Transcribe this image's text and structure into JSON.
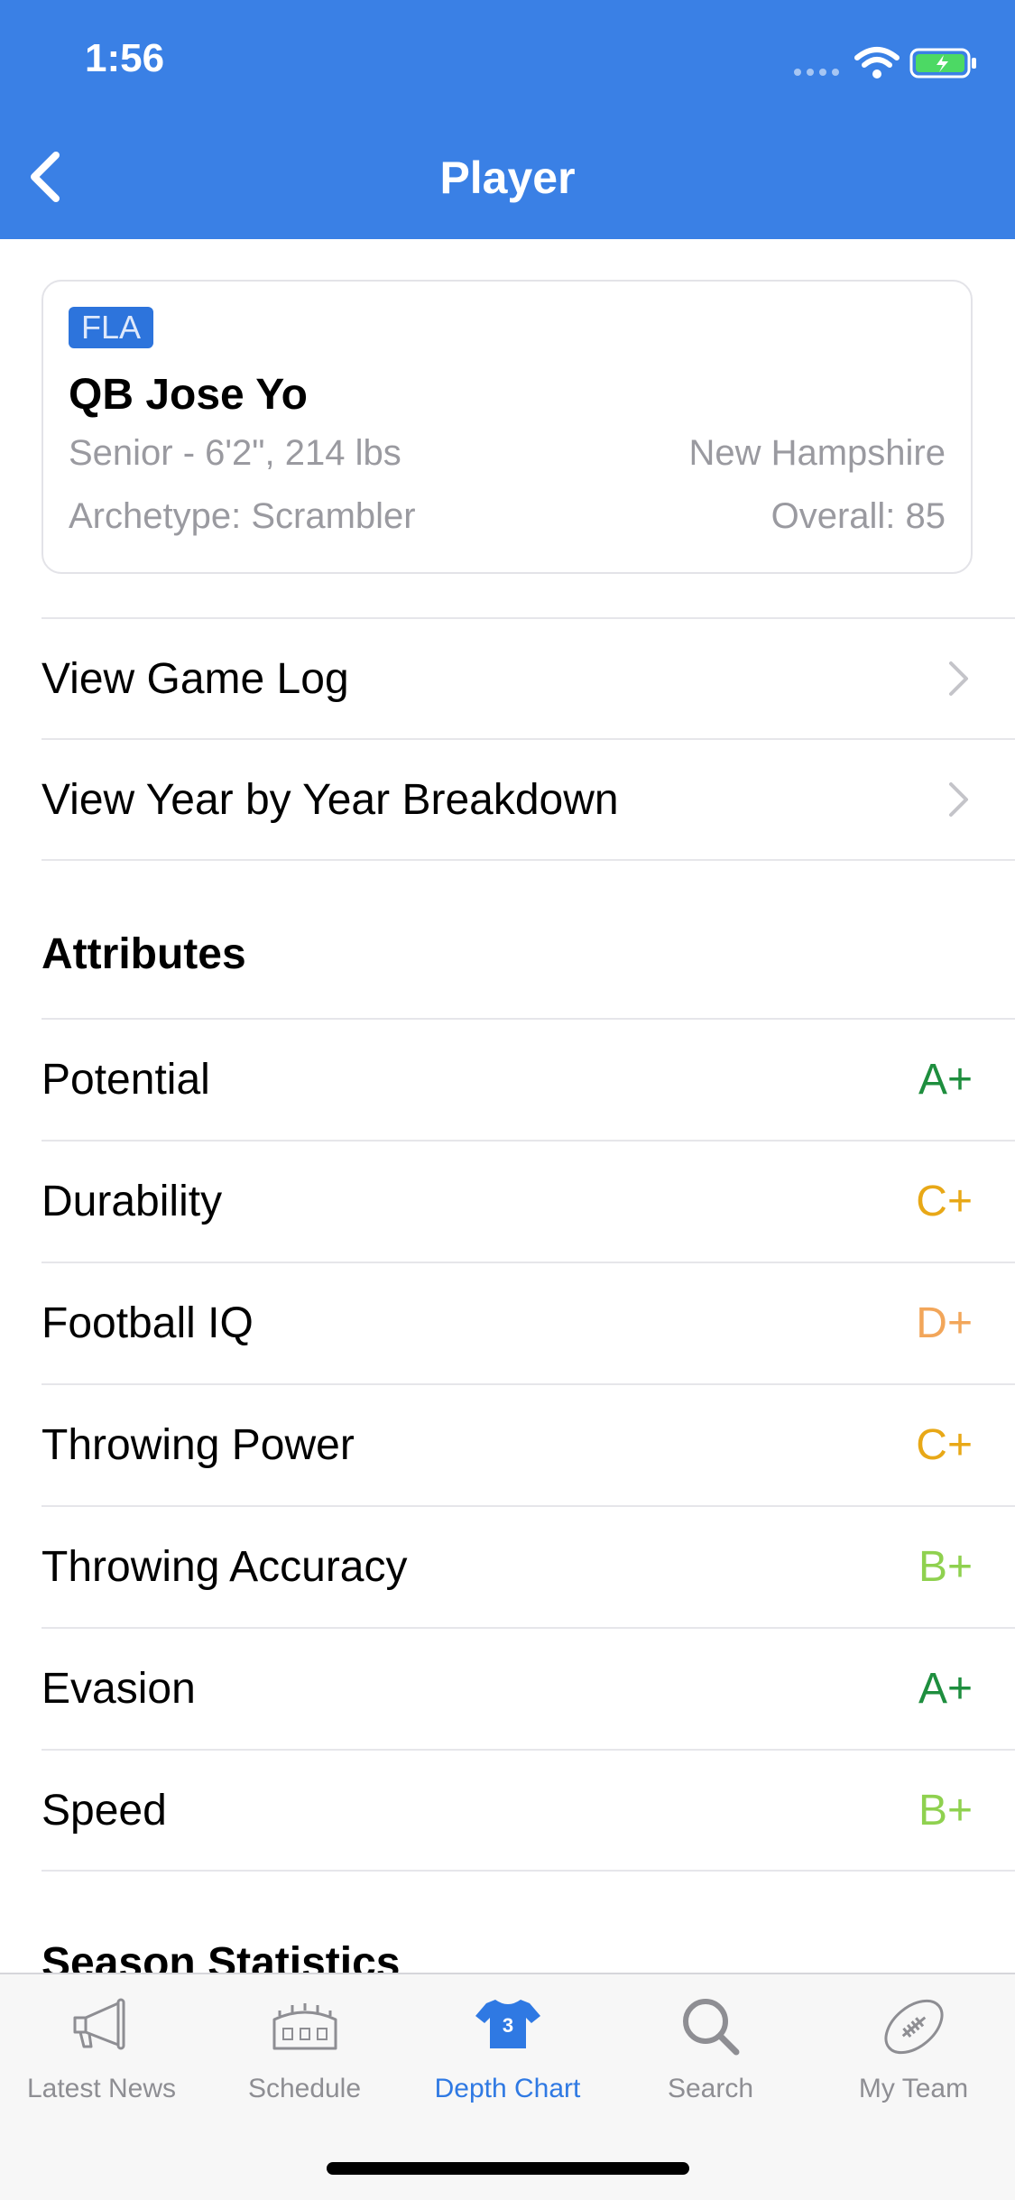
{
  "status_bar": {
    "time": "1:56"
  },
  "nav": {
    "title": "Player",
    "back_icon": "chevron-left-icon"
  },
  "player": {
    "team": "FLA",
    "name": "QB Jose Yo",
    "details": "Senior - 6'2\", 214 lbs",
    "hometown": "New Hampshire",
    "archetype": "Archetype: Scrambler",
    "overall": "Overall: 85"
  },
  "links": [
    {
      "label": "View Game Log"
    },
    {
      "label": "View Year by Year Breakdown"
    }
  ],
  "attributes": {
    "title": "Attributes",
    "items": [
      {
        "label": "Potential",
        "grade": "A+",
        "color": "#1e8e3e"
      },
      {
        "label": "Durability",
        "grade": "C+",
        "color": "#e8a817"
      },
      {
        "label": "Football IQ",
        "grade": "D+",
        "color": "#f2a65a"
      },
      {
        "label": "Throwing Power",
        "grade": "C+",
        "color": "#e8a817"
      },
      {
        "label": "Throwing Accuracy",
        "grade": "B+",
        "color": "#8fd14f"
      },
      {
        "label": "Evasion",
        "grade": "A+",
        "color": "#1e8e3e"
      },
      {
        "label": "Speed",
        "grade": "B+",
        "color": "#8fd14f"
      }
    ]
  },
  "season_statistics": {
    "title": "Season Statistics"
  },
  "tabbar": {
    "items": [
      {
        "label": "Latest News",
        "icon": "megaphone-icon"
      },
      {
        "label": "Schedule",
        "icon": "stadium-icon"
      },
      {
        "label": "Depth Chart",
        "icon": "jersey-icon",
        "badge": "3",
        "active": true
      },
      {
        "label": "Search",
        "icon": "magnifier-icon"
      },
      {
        "label": "My Team",
        "icon": "football-icon"
      }
    ]
  },
  "colors": {
    "header": "#3a80e5",
    "accent": "#2f79e3"
  }
}
